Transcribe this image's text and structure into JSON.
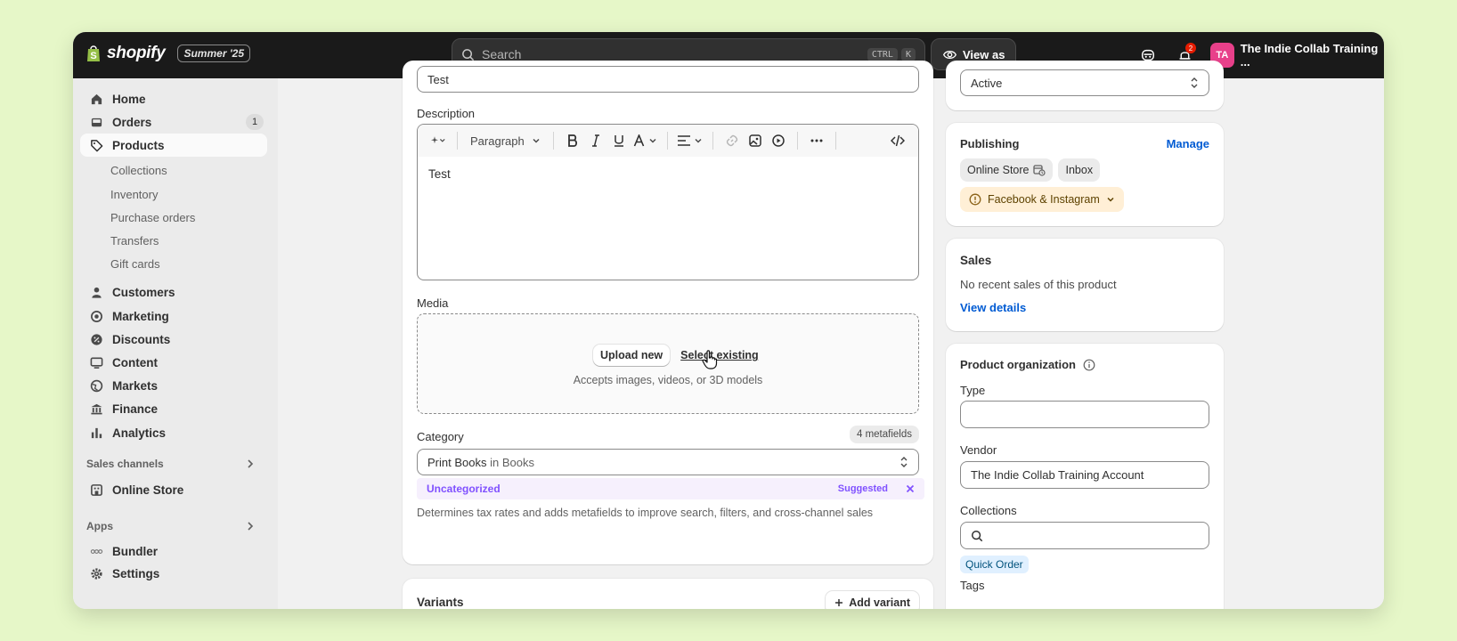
{
  "topbar": {
    "brand": "shopify",
    "edition": "Summer '25",
    "search_placeholder": "Search",
    "shortcut_ctrl": "CTRL",
    "shortcut_k": "K",
    "view_as": "View as",
    "notification_count": "2",
    "avatar_initials": "TA",
    "store_name": "The Indie Collab Training ..."
  },
  "sidebar": {
    "home": "Home",
    "orders": "Orders",
    "orders_count": "1",
    "products": "Products",
    "collections": "Collections",
    "inventory": "Inventory",
    "purchase_orders": "Purchase orders",
    "transfers": "Transfers",
    "gift_cards": "Gift cards",
    "customers": "Customers",
    "marketing": "Marketing",
    "discounts": "Discounts",
    "content": "Content",
    "markets": "Markets",
    "finance": "Finance",
    "analytics": "Analytics",
    "sales_channels": "Sales channels",
    "online_store": "Online Store",
    "apps": "Apps",
    "bundler": "Bundler",
    "settings": "Settings"
  },
  "product": {
    "title_value": "Test",
    "description_label": "Description",
    "paragraph_select": "Paragraph",
    "description_text": "Test",
    "media_label": "Media",
    "upload_new": "Upload new",
    "select_existing": "Select existing",
    "media_hint": "Accepts images, videos, or 3D models",
    "category_label": "Category",
    "metafields_badge": "4 metafields",
    "category_value_main": "Print Books",
    "category_value_sub": " in Books",
    "uncategorized": "Uncategorized",
    "suggested": "Suggested",
    "category_help": "Determines tax rates and adds metafields to improve search, filters, and cross-channel sales",
    "variants_title": "Variants",
    "add_variant": "Add variant"
  },
  "status": {
    "value": "Active"
  },
  "publishing": {
    "title": "Publishing",
    "manage": "Manage",
    "online_store": "Online Store",
    "inbox": "Inbox",
    "facebook": "Facebook & Instagram"
  },
  "sales": {
    "title": "Sales",
    "text": "No recent sales of this product",
    "view_details": "View details"
  },
  "organization": {
    "title": "Product organization",
    "type_label": "Type",
    "type_value": "",
    "vendor_label": "Vendor",
    "vendor_value": "The Indie Collab Training Account",
    "collections_label": "Collections",
    "collection_tag": "Quick Order",
    "tags_label": "Tags"
  }
}
